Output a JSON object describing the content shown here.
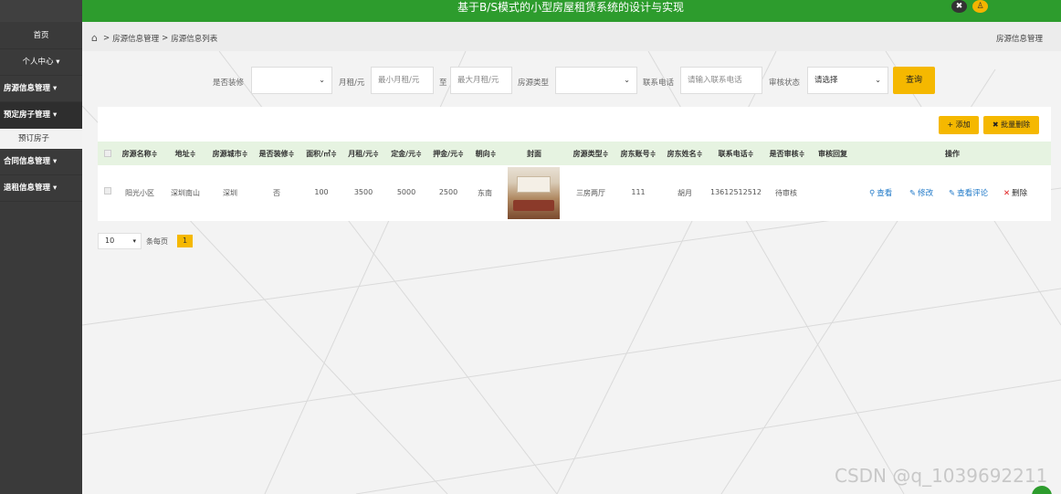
{
  "header": {
    "title": "基于B/S模式的小型房屋租赁系统的设计与实现",
    "close_icon": "close-icon",
    "user_icon": "user-icon"
  },
  "sidebar": {
    "items": [
      {
        "label": "首页"
      },
      {
        "label": "个人中心 ▾"
      },
      {
        "label": "房源信息管理 ▾"
      },
      {
        "label": "预定房子管理 ▾"
      },
      {
        "label": "预订房子"
      },
      {
        "label": "合同信息管理 ▾"
      },
      {
        "label": "退租信息管理 ▾"
      }
    ]
  },
  "breadcrumb": {
    "home": "⌂",
    "parts": [
      "房源信息管理",
      "房源信息列表"
    ],
    "sep": ">",
    "right": "房源信息管理"
  },
  "search": {
    "decoration_label": "是否装修",
    "decoration_value": "",
    "rent_label": "月租/元",
    "rent_min_placeholder": "最小月租/元",
    "to_label": "至",
    "rent_max_placeholder": "最大月租/元",
    "type_label": "房源类型",
    "type_value": "",
    "phone_label": "联系电话",
    "phone_placeholder": "请输入联系电话",
    "audit_label": "审核状态",
    "audit_value": "请选择",
    "query_button": "查询"
  },
  "toolbar": {
    "add_button": "+ 添加",
    "batch_delete_button": "✖ 批量删除"
  },
  "table": {
    "headers": [
      "房源名称≑",
      "地址≑",
      "房源城市≑",
      "是否装修≑",
      "面积/㎡≑",
      "月租/元≑",
      "定金/元≑",
      "押金/元≑",
      "朝向≑",
      "封面",
      "房源类型≑",
      "房东账号≑",
      "房东姓名≑",
      "联系电话≑",
      "是否审核≑",
      "审核回复",
      "操作"
    ],
    "rows": [
      {
        "name": "阳光小区",
        "address": "深圳南山",
        "city": "深圳",
        "decorated": "否",
        "area": "100",
        "rent": "3500",
        "deposit_booking": "5000",
        "deposit": "2500",
        "orientation": "东南",
        "type": "三房两厅",
        "landlord_account": "111",
        "landlord_name": "胡月",
        "phone": "13612512512",
        "audit": "待审核",
        "audit_reply": "",
        "ops": {
          "view": "查看",
          "edit": "修改",
          "view_comments": "查看评论",
          "delete": "删除"
        }
      }
    ]
  },
  "pagination": {
    "page_size": "10",
    "per_page_label": "条每页",
    "current_page": "1"
  },
  "watermark": "CSDN @q_1039692211",
  "colors": {
    "header_green": "#2d9c2d",
    "accent_yellow": "#f5b800",
    "sidebar_dark": "#3a3a3a",
    "table_head_bg": "#e6f3e1",
    "link_blue": "#1e78c8"
  }
}
